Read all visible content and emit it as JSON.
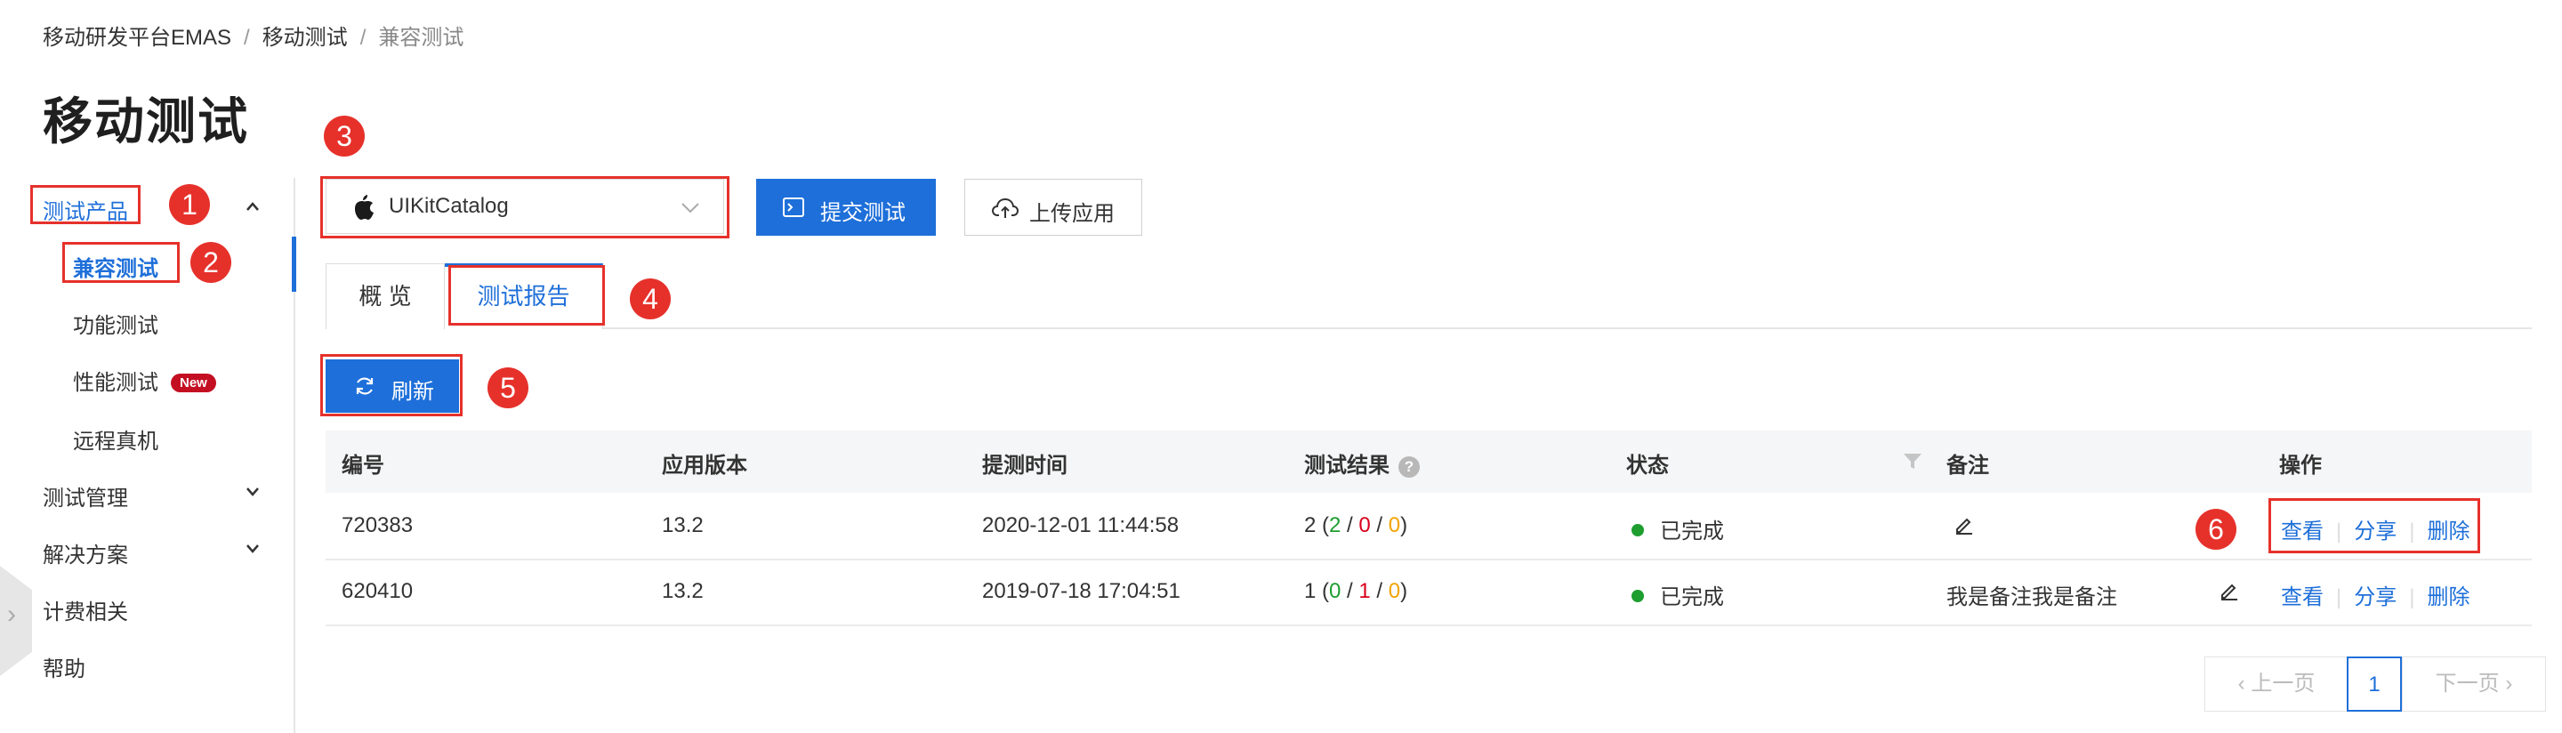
{
  "breadcrumb": {
    "items": [
      "移动研发平台EMAS",
      "移动测试",
      "兼容测试"
    ]
  },
  "page": {
    "title": "移动测试"
  },
  "sidebar": {
    "groups": [
      {
        "label": "测试产品",
        "expanded": true
      },
      {
        "label": "测试管理"
      },
      {
        "label": "解决方案"
      },
      {
        "label": "计费相关"
      },
      {
        "label": "帮助"
      }
    ],
    "sub_items": [
      "兼容测试",
      "功能测试",
      "性能测试",
      "远程真机"
    ],
    "new_badge": "New"
  },
  "toolbar": {
    "app_name": "UIKitCatalog",
    "submit_label": "提交测试",
    "upload_label": "上传应用"
  },
  "tabs": [
    "概 览",
    "测试报告"
  ],
  "actions": {
    "refresh_label": "刷新"
  },
  "table": {
    "headers": [
      "编号",
      "应用版本",
      "提测时间",
      "测试结果",
      "状态",
      "备注",
      "操作"
    ],
    "help_glyph": "?",
    "rows": [
      {
        "id": "720383",
        "version": "13.2",
        "time": "2020-12-01 11:44:58",
        "result_total": "2",
        "pass": "2",
        "fail": "0",
        "warn": "0",
        "status": "已完成",
        "remark": ""
      },
      {
        "id": "620410",
        "version": "13.2",
        "time": "2019-07-18 17:04:51",
        "result_total": "1",
        "pass": "0",
        "fail": "1",
        "warn": "0",
        "status": "已完成",
        "remark": "我是备注我是备注"
      }
    ],
    "ops": [
      "查看",
      "分享",
      "删除"
    ]
  },
  "pagination": {
    "prev_label": "上一页",
    "current_page": "1",
    "next_label": "下一页"
  },
  "annotations": [
    "1",
    "2",
    "3",
    "4",
    "5",
    "6"
  ],
  "colors": {
    "primary": "#1e6fd9",
    "annotation_red": "#e6312b",
    "success": "#1e9e2f",
    "fail": "#d9001b",
    "warn": "#f1a300",
    "new_badge": "#c40f22"
  },
  "icons": [
    "apple-icon",
    "terminal-icon",
    "cloud-upload-icon",
    "refresh-icon",
    "chevron-down-icon",
    "filter-icon",
    "edit-icon",
    "help-icon"
  ]
}
